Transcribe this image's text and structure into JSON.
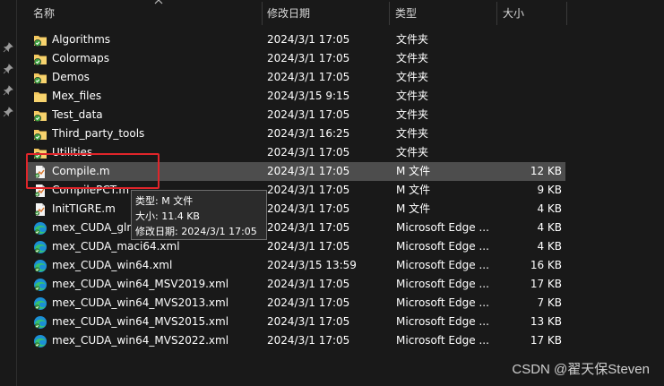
{
  "header": {
    "name_label": "名称",
    "date_label": "修改日期",
    "type_label": "类型",
    "size_label": "大小"
  },
  "files": [
    {
      "name": "Algorithms",
      "date": "2024/3/1 17:05",
      "type": "文件夹",
      "size": "",
      "icon": "folder-sync-icon"
    },
    {
      "name": "Colormaps",
      "date": "2024/3/1 17:05",
      "type": "文件夹",
      "size": "",
      "icon": "folder-sync-icon"
    },
    {
      "name": "Demos",
      "date": "2024/3/1 17:05",
      "type": "文件夹",
      "size": "",
      "icon": "folder-sync-icon"
    },
    {
      "name": "Mex_files",
      "date": "2024/3/15 9:15",
      "type": "文件夹",
      "size": "",
      "icon": "folder-icon"
    },
    {
      "name": "Test_data",
      "date": "2024/3/1 17:05",
      "type": "文件夹",
      "size": "",
      "icon": "folder-sync-icon"
    },
    {
      "name": "Third_party_tools",
      "date": "2024/3/1 16:25",
      "type": "文件夹",
      "size": "",
      "icon": "folder-sync-icon"
    },
    {
      "name": "Utilities",
      "date": "2024/3/1 17:05",
      "type": "文件夹",
      "size": "",
      "icon": "folder-sync-icon"
    },
    {
      "name": "Compile.m",
      "date": "2024/3/1 17:05",
      "type": "M 文件",
      "size": "12 KB",
      "icon": "matlab-file-icon"
    },
    {
      "name": "CompilePCT.m",
      "date": "2024/3/1 17:05",
      "type": "M 文件",
      "size": "9 KB",
      "icon": "matlab-file-icon"
    },
    {
      "name": "InitTIGRE.m",
      "date": "2024/3/1 17:05",
      "type": "M 文件",
      "size": "4 KB",
      "icon": "matlab-file-icon"
    },
    {
      "name": "mex_CUDA_gln",
      "date": "2024/3/1 17:05",
      "type": "Microsoft Edge ...",
      "size": "4 KB",
      "icon": "edge-xml-icon"
    },
    {
      "name": "mex_CUDA_maci64.xml",
      "date": "2024/3/1 17:05",
      "type": "Microsoft Edge ...",
      "size": "4 KB",
      "icon": "edge-xml-icon"
    },
    {
      "name": "mex_CUDA_win64.xml",
      "date": "2024/3/15 13:59",
      "type": "Microsoft Edge ...",
      "size": "16 KB",
      "icon": "edge-xml-icon"
    },
    {
      "name": "mex_CUDA_win64_MSV2019.xml",
      "date": "2024/3/1 17:05",
      "type": "Microsoft Edge ...",
      "size": "17 KB",
      "icon": "edge-xml-icon"
    },
    {
      "name": "mex_CUDA_win64_MVS2013.xml",
      "date": "2024/3/1 17:05",
      "type": "Microsoft Edge ...",
      "size": "7 KB",
      "icon": "edge-xml-icon"
    },
    {
      "name": "mex_CUDA_win64_MVS2015.xml",
      "date": "2024/3/1 17:05",
      "type": "Microsoft Edge ...",
      "size": "13 KB",
      "icon": "edge-xml-icon"
    },
    {
      "name": "mex_CUDA_win64_MVS2022.xml",
      "date": "2024/3/1 17:05",
      "type": "Microsoft Edge ...",
      "size": "17 KB",
      "icon": "edge-xml-icon"
    }
  ],
  "tooltip": {
    "type_line": "类型: M 文件",
    "size_line": "大小: 11.4 KB",
    "date_line": "修改日期: 2024/3/1 17:05"
  },
  "watermark": "CSDN @翟天保Steven",
  "colors": {
    "background": "#191919",
    "hover_row": "#4d4d4d",
    "highlight_box": "#e0252a",
    "folder": "#f2c55c",
    "sync_check": "#3ea33e"
  }
}
